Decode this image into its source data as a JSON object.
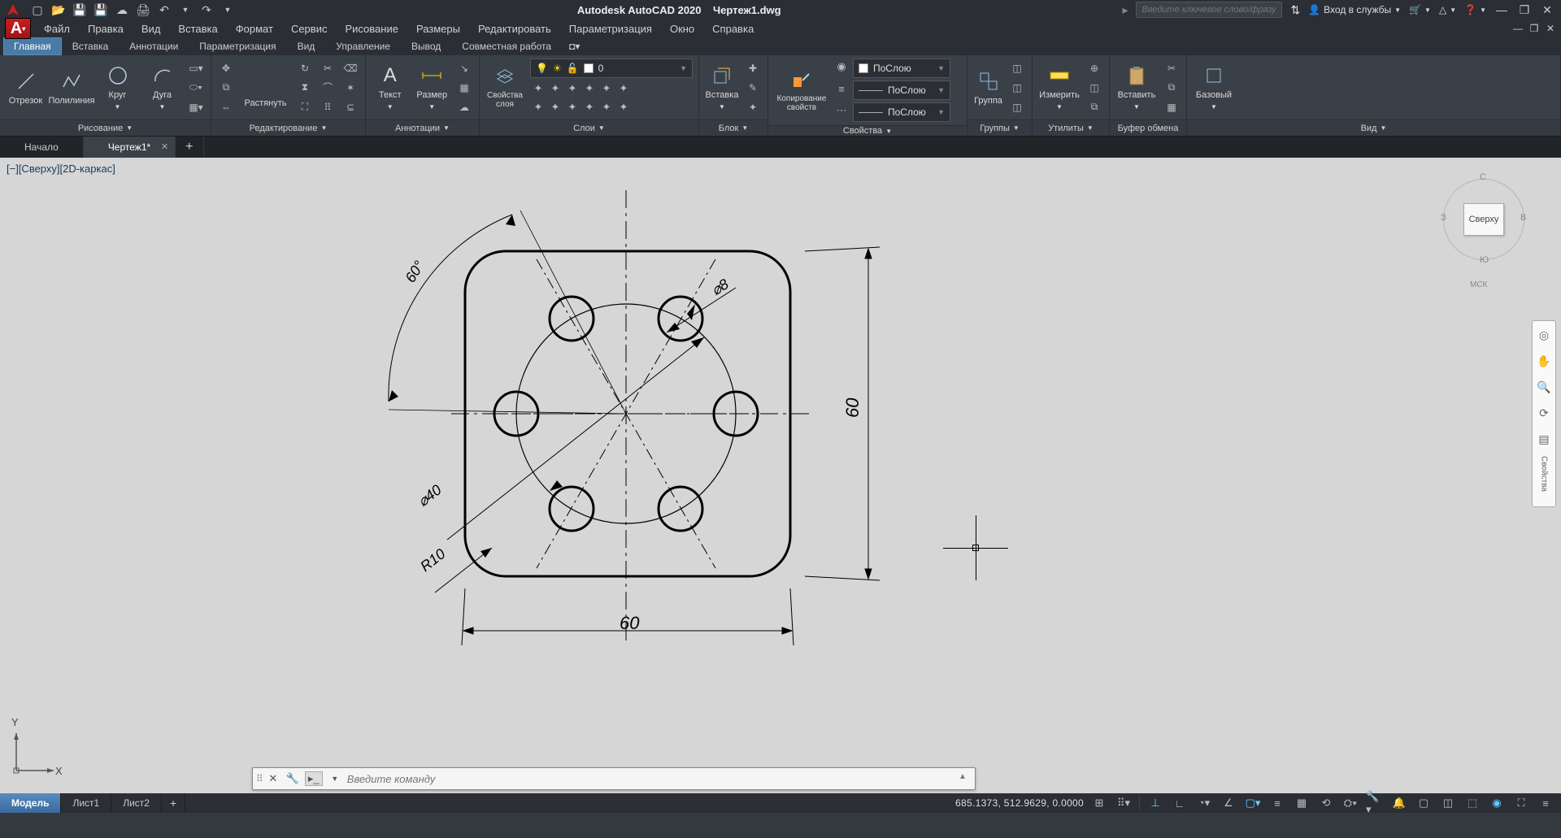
{
  "title": "Autodesk AutoCAD 2020",
  "file": "Чертеж1.dwg",
  "search_placeholder": "Введите ключевое слово/фразу",
  "signin": "Вход в службы",
  "menu": [
    "Файл",
    "Правка",
    "Вид",
    "Вставка",
    "Формат",
    "Сервис",
    "Рисование",
    "Размеры",
    "Редактировать",
    "Параметризация",
    "Окно",
    "Справка"
  ],
  "ribbon_tabs": [
    "Главная",
    "Вставка",
    "Аннотации",
    "Параметризация",
    "Вид",
    "Управление",
    "Вывод",
    "Совместная работа"
  ],
  "ribbon_active": 0,
  "panels": {
    "draw": {
      "label": "Рисование",
      "btns": [
        "Отрезок",
        "Полилиния",
        "Круг",
        "Дуга"
      ]
    },
    "modify": {
      "label": "Редактирование",
      "btn": "Растянуть"
    },
    "annot": {
      "label": "Аннотации",
      "btns": [
        "Текст",
        "Размер"
      ]
    },
    "layers": {
      "label": "Слои",
      "btn": "Свойства слоя",
      "current": "0"
    },
    "block": {
      "label": "Блок",
      "btn": "Вставка"
    },
    "props": {
      "label": "Свойства",
      "btn": "Копирование свойств",
      "bylayer": "ПоСлою"
    },
    "groups": {
      "label": "Группы",
      "btn": "Группа"
    },
    "utils": {
      "label": "Утилиты",
      "btn": "Измерить"
    },
    "clip": {
      "label": "Буфер обмена",
      "btn": "Вставить"
    },
    "view": {
      "label": "Вид",
      "btn": "Базовый"
    }
  },
  "file_tabs": [
    {
      "label": "Начало",
      "active": false
    },
    {
      "label": "Чертеж1*",
      "active": true
    }
  ],
  "view_label": "[−][Сверху][2D-каркас]",
  "viewcube": {
    "top": "Сверху",
    "n": "С",
    "s": "Ю",
    "e": "В",
    "w": "З",
    "wcs": "МСК"
  },
  "nav_panel_label": "Свойства",
  "dims": {
    "width": "60",
    "height": "60",
    "radius": "R10",
    "angle": "60°",
    "bolt_dia": "⌀40",
    "hole_dia": "⌀8"
  },
  "cmd_placeholder": "Введите команду",
  "layouts": [
    "Модель",
    "Лист1",
    "Лист2"
  ],
  "layouts_active": 0,
  "coords": "685.1373, 512.9629, 0.0000",
  "ucs": {
    "x": "X",
    "y": "Y"
  }
}
